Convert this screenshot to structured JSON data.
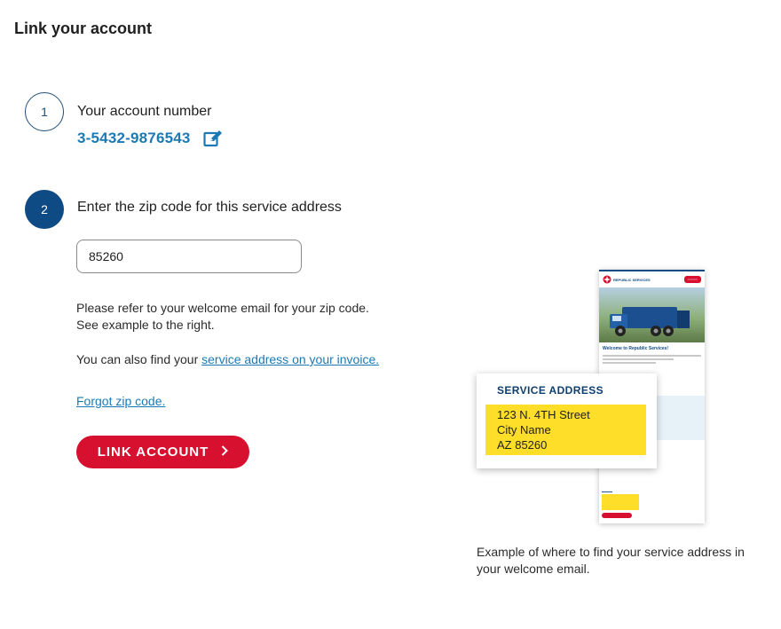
{
  "page": {
    "title": "Link your account"
  },
  "step1": {
    "number": "1",
    "heading": "Your account number",
    "account_number": "3-5432-9876543"
  },
  "step2": {
    "number": "2",
    "heading": "Enter the zip code for this service address",
    "zip_value": "85260"
  },
  "help": {
    "line1": "Please refer to your welcome email for your zip code.",
    "line2": "See example to the right.",
    "line3_prefix": "You can also find your ",
    "line3_link": "service address on your invoice."
  },
  "forgot_link": "Forgot zip code.",
  "link_button": {
    "label": "LINK ACCOUNT",
    "icon": "chevron-right-icon"
  },
  "example": {
    "callout_title": "SERVICE ADDRESS",
    "address_line1": "123 N. 4TH Street",
    "address_line2": "City Name",
    "address_line3": "AZ 85260",
    "caption": "Example of where to find your service address in your welcome email.",
    "email_welcome": "Welcome to Republic Services!",
    "email_logo": "REPUBLIC SERVICES"
  },
  "colors": {
    "primary_blue": "#0e4a84",
    "link_blue": "#1b7ab5",
    "brand_red": "#d6102e",
    "highlight_yellow": "#ffde2a"
  }
}
